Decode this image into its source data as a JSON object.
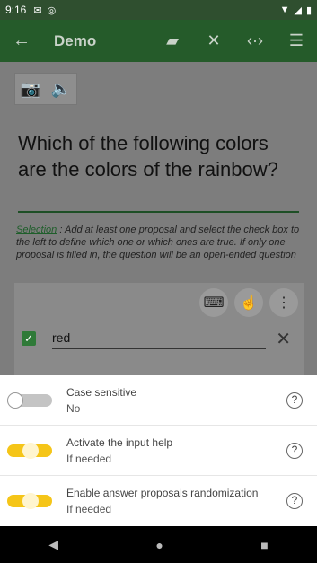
{
  "status": {
    "time": "9:16"
  },
  "app_bar": {
    "title": "Demo",
    "back_icon": "arrow-left-icon",
    "actions": [
      "sd-card-icon",
      "close-icon",
      "code-arrows-icon",
      "list-icon"
    ]
  },
  "media": {
    "camera_icon": "add-photo-icon",
    "audio_icon": "add-audio-icon"
  },
  "question": {
    "text": "Which of the following colors are the colors of the rainbow?"
  },
  "hint": {
    "keyword": "Selection",
    "text": " : Add at least one proposal and select the check box to the left to define which one or which ones are true. If only one proposal is filled in, the question will be an open-ended question"
  },
  "proposal": {
    "value": "red",
    "checked": true
  },
  "settings": [
    {
      "label": "Case sensitive",
      "value": "No",
      "enabled": false
    },
    {
      "label": "Activate the input help",
      "value": "If needed",
      "enabled": true
    },
    {
      "label": "Enable answer proposals randomization",
      "value": "If needed",
      "enabled": true
    }
  ],
  "colors": {
    "primary": "#255b2a",
    "accent": "#f5c518"
  }
}
